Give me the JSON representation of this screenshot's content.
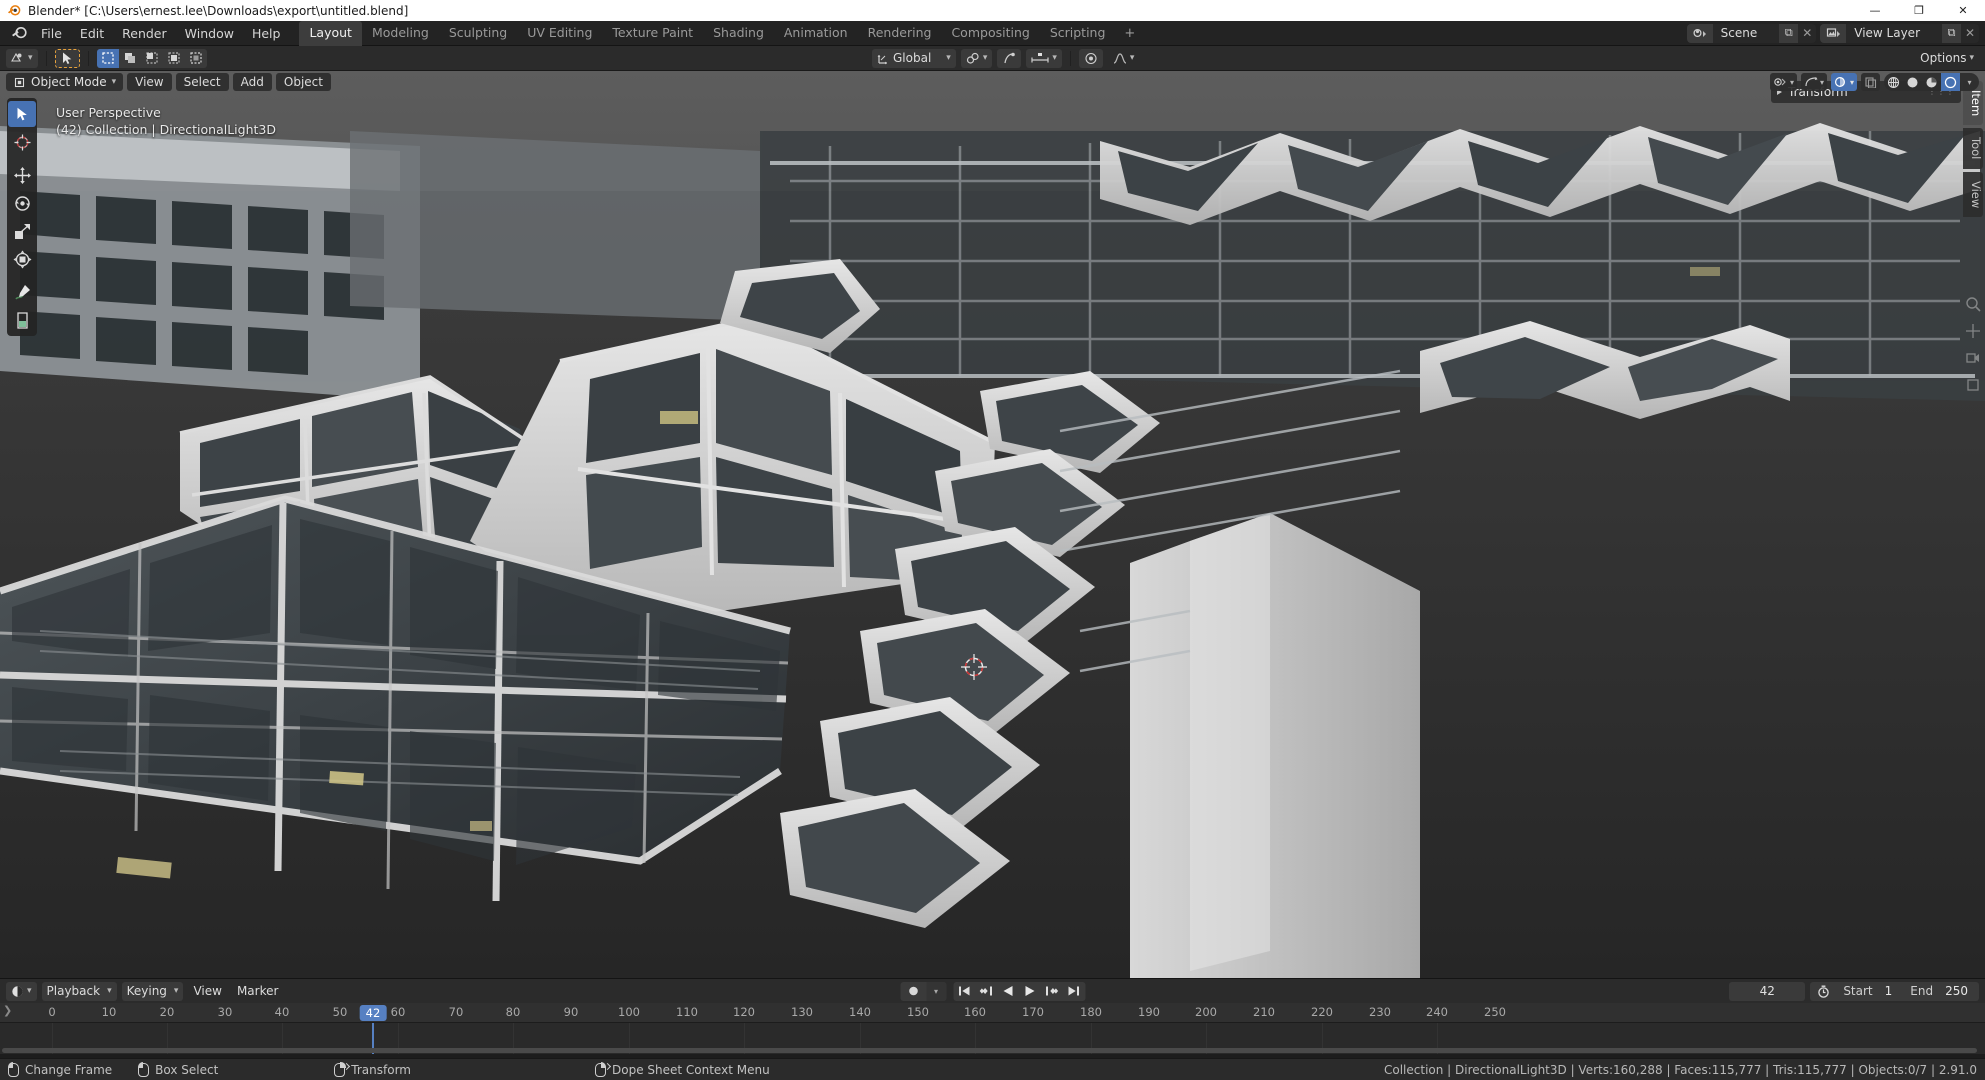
{
  "titlebar": {
    "text": "Blender* [C:\\Users\\ernest.lee\\Downloads\\export\\untitled.blend]",
    "minimize": "—",
    "maximize": "❐",
    "close": "✕"
  },
  "topbar": {
    "menus": [
      "File",
      "Edit",
      "Render",
      "Window",
      "Help"
    ],
    "workspace_tabs": [
      {
        "label": "Layout",
        "active": true
      },
      {
        "label": "Modeling",
        "active": false
      },
      {
        "label": "Sculpting",
        "active": false
      },
      {
        "label": "UV Editing",
        "active": false
      },
      {
        "label": "Texture Paint",
        "active": false
      },
      {
        "label": "Shading",
        "active": false
      },
      {
        "label": "Animation",
        "active": false
      },
      {
        "label": "Rendering",
        "active": false
      },
      {
        "label": "Compositing",
        "active": false
      },
      {
        "label": "Scripting",
        "active": false
      }
    ],
    "add_workspace": "+",
    "scene_name": "Scene",
    "view_layer_name": "View Layer",
    "new_button": "⧉",
    "unlink_button": "✕"
  },
  "viewport_header": {
    "editor_type": "3d-viewport-icon",
    "transform_orientation": "Global",
    "snap_enabled": false,
    "proportional_editing": false,
    "options_label": "Options",
    "select_modes": [
      "tweak",
      "box-select",
      "circle-select",
      "lasso-select"
    ],
    "active_select_mode": "box-select"
  },
  "mode_row": {
    "mode": "Object Mode",
    "menus": [
      "View",
      "Select",
      "Add",
      "Object"
    ],
    "shading_modes": [
      "wireframe",
      "solid",
      "material-preview",
      "rendered"
    ],
    "active_shading": "rendered"
  },
  "viewport": {
    "perspective_label": "User Perspective",
    "scene_info": "(42) Collection | DirectionalLight3D",
    "toolbar_tools": [
      {
        "name": "tweak-tool",
        "active": true
      },
      {
        "name": "cursor-tool",
        "active": false
      },
      {
        "name": "move-tool",
        "active": false
      },
      {
        "name": "rotate-tool",
        "active": false
      },
      {
        "name": "scale-tool",
        "active": false
      },
      {
        "name": "transform-tool",
        "active": false
      },
      {
        "name": "annotate-tool",
        "active": false
      },
      {
        "name": "measure-tool",
        "active": false
      }
    ],
    "npanel": {
      "panel_title": "Transform",
      "tabs": [
        {
          "label": "Item",
          "active": true
        },
        {
          "label": "Tool",
          "active": false
        },
        {
          "label": "View",
          "active": false
        }
      ]
    }
  },
  "timeline": {
    "editor_icon": "timeline-icon",
    "menus": [
      "Playback",
      "Keying",
      "View",
      "Marker"
    ],
    "current_frame": "42",
    "start_label": "Start",
    "start_value": "1",
    "end_label": "End",
    "end_value": "250",
    "playhead_label": "42",
    "ruler_ticks": [
      "0",
      "10",
      "20",
      "30",
      "40",
      "50",
      "60",
      "70",
      "80",
      "90",
      "100",
      "110",
      "120",
      "130",
      "140",
      "150",
      "160",
      "170",
      "180",
      "190",
      "200",
      "210",
      "220",
      "230",
      "240",
      "250"
    ],
    "transport": [
      "jump-to-start",
      "jump-prev-keyframe",
      "play-reverse",
      "play",
      "jump-next-keyframe",
      "jump-to-end"
    ],
    "auto_keying": "record-icon"
  },
  "statusbar": {
    "hints": [
      {
        "mouse": "left",
        "label": "Change Frame"
      },
      {
        "mouse": "left",
        "label": "Box Select"
      },
      {
        "mouse": "right",
        "label": "Transform"
      },
      {
        "mouse": "right",
        "label": "Dope Sheet Context Menu"
      }
    ],
    "scene_stats": "Collection | DirectionalLight3D | Verts:160,288 | Faces:115,777 | Tris:115,777 | Objects:0/7 | 2.91.0"
  },
  "colors": {
    "accent_blue": "#4772b3",
    "playhead_blue": "#5680c2",
    "tool_orange": "#e8a33d",
    "panel_bg": "#2b2b2b",
    "viewport_bg": "#3b3b3b"
  }
}
